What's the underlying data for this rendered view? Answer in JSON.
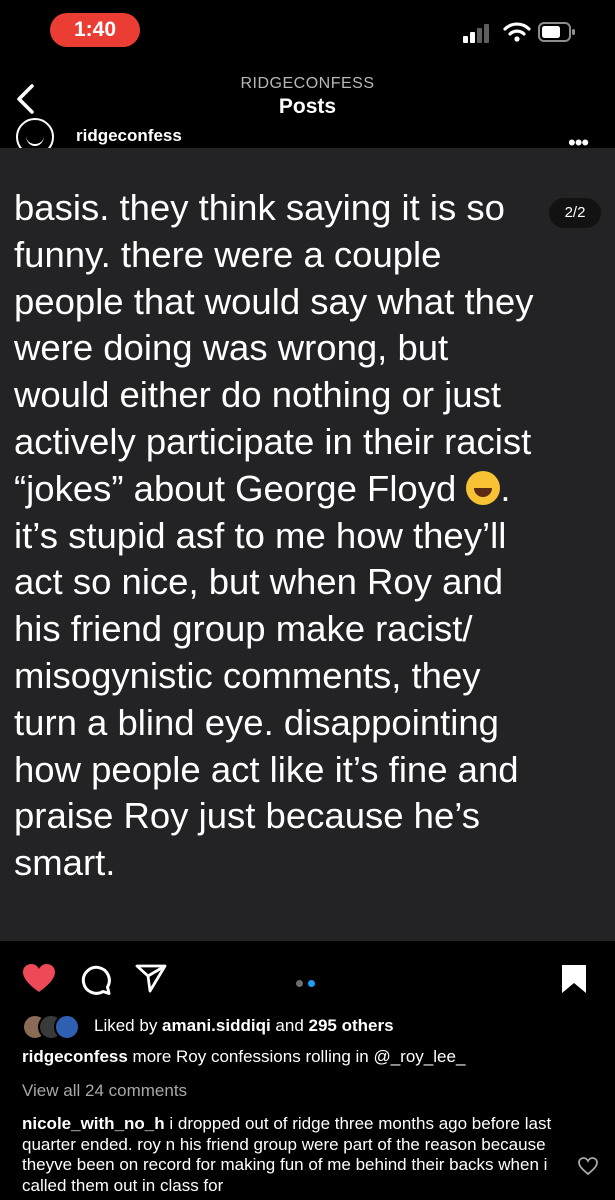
{
  "status_bar": {
    "time": "1:40",
    "time_pill_color": "#ec3d35"
  },
  "nav": {
    "username": "RIDGECONFESS",
    "title": "Posts",
    "back_icon": "chevron-left-icon"
  },
  "post": {
    "username": "ridgeconfess",
    "more_icon": "more-horizontal-icon",
    "page_indicator": "2/2",
    "lines": [
      "basis. they think saying it is so",
      "funny. there were a couple",
      "people that would say what they",
      "were doing was wrong, but",
      "would either do nothing or just",
      "actively participate in their racist",
      "“jokes” about George Floyd ",
      "it’s stupid asf to me how they’ll",
      "act so nice, but when Roy and",
      "his friend group make racist/",
      "misogynistic comments, they",
      "turn a blind eye. disappointing",
      "how people act like it’s fine and",
      "praise Roy just because he’s",
      "smart."
    ],
    "line7_tail": "."
  },
  "actions": {
    "heart_icon": "heart-filled-icon",
    "comment_icon": "comment-icon",
    "share_icon": "share-icon",
    "bookmark_icon": "bookmark-icon",
    "like_color": "#ed4956",
    "carousel": {
      "count": 2,
      "active_index": 1,
      "active_color": "#1c9ef7"
    }
  },
  "likes": {
    "prefix": "Liked by ",
    "user": "amani.siddiqi",
    "middle": " and ",
    "others": "295 others"
  },
  "caption": {
    "username": "ridgeconfess",
    "text": " more Roy confessions rolling in @_roy_lee_"
  },
  "view_comments": "View all 24 comments",
  "comment": {
    "username": "nicole_with_no_h",
    "text": " i dropped out of ridge three months ago before last quarter ended. roy n his friend group were part of the reason because theyve been on record for making fun of me behind their backs when i called them out in class for"
  }
}
